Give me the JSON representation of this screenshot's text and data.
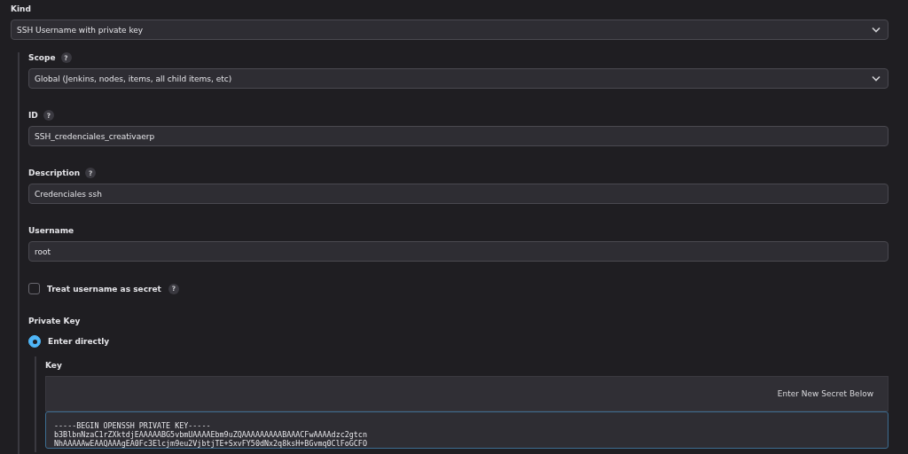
{
  "kind": {
    "label": "Kind",
    "value": "SSH Username with private key"
  },
  "fields": [
    {
      "kind": "select",
      "label": "Scope",
      "help": "?",
      "value": "Global (Jenkins, nodes, items, all child items, etc)"
    },
    {
      "kind": "text",
      "label": "ID",
      "help": "?",
      "value": "SSH_credenciales_creativaerp"
    },
    {
      "kind": "text",
      "label": "Description",
      "help": "?",
      "value": "Credenciales ssh"
    },
    {
      "kind": "text",
      "label": "Username",
      "value": "root"
    }
  ],
  "treat_secret": {
    "label": "Treat username as secret",
    "help": "?",
    "checked": false
  },
  "private_key": {
    "label": "Private Key",
    "options": [
      {
        "label": "Enter directly",
        "selected": true
      }
    ],
    "key": {
      "label": "Key",
      "hint": "Enter New Secret Below",
      "lines": [
        "-----BEGIN OPENSSH PRIVATE KEY-----",
        "b3BlbnNzaC1rZXktdjEAAAAABG5vbmUAAAAEbm9uZQAAAAAAAAABAAACFwAAAAdzc2gtcn",
        "NhAAAAAwEAAQAAAgEA0Fc3Elcjm9eu2VjbtjTE+SxvFY50dNx2q8ksH+BGvmq0ClFoGCFO"
      ]
    }
  }
}
